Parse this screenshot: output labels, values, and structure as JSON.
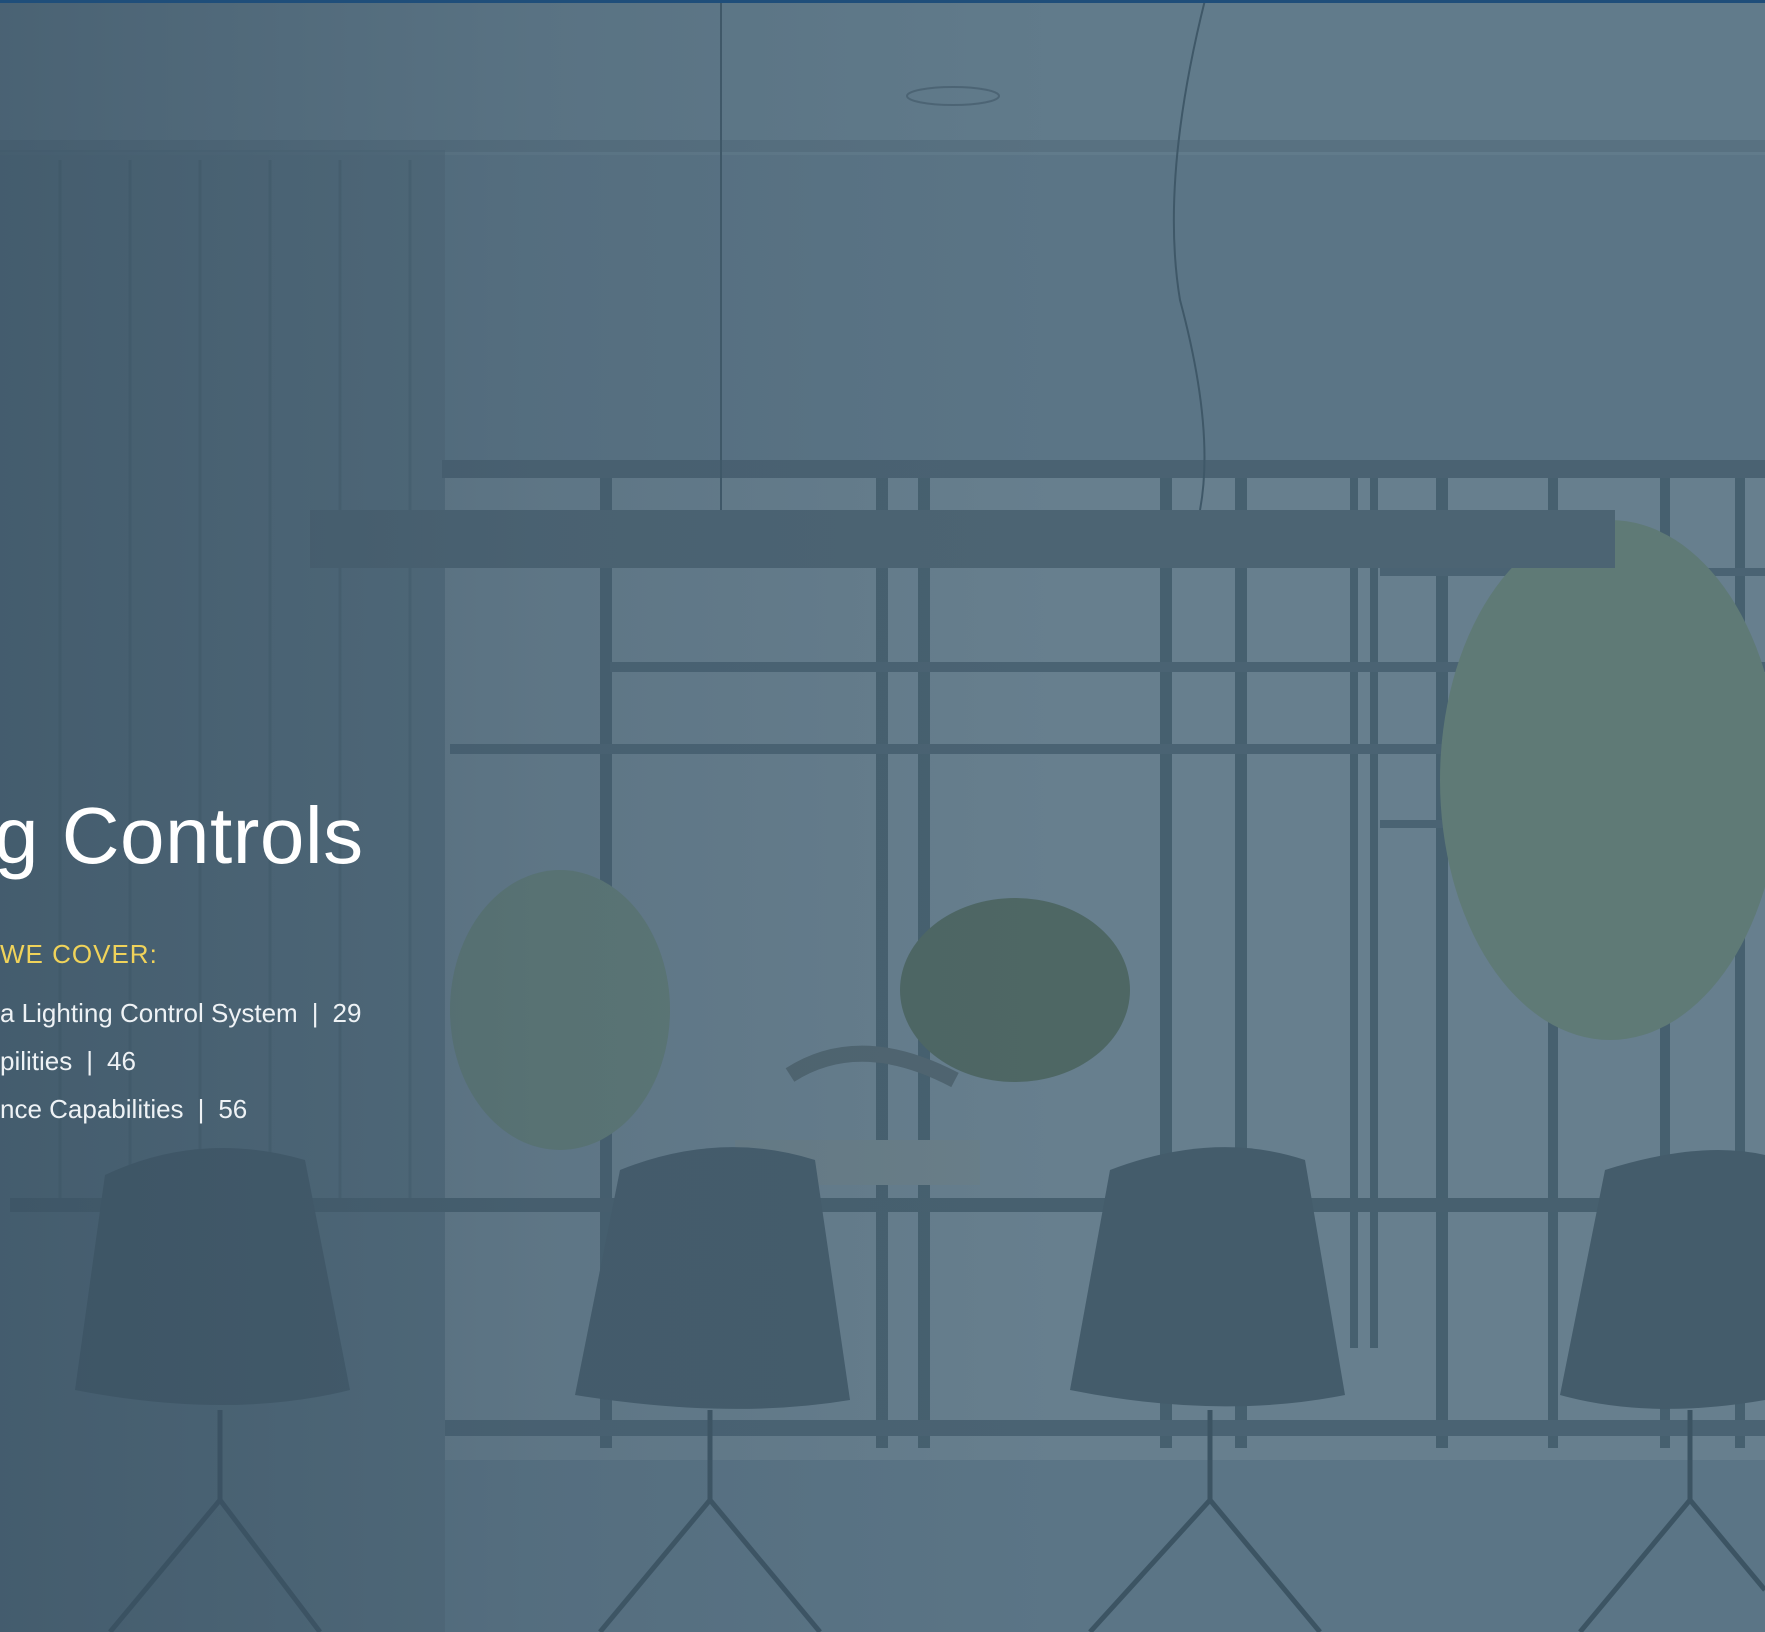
{
  "colors": {
    "title": "#ffffff",
    "heading_accent": "#f0d35a",
    "topic_text": "#eef2f5",
    "top_rule": "#1f4e7a",
    "background_tint": "#5a7384"
  },
  "title": "g Controls",
  "cover_heading": "WE COVER:",
  "topics": [
    {
      "text": "a Lighting Control System",
      "separator": "|",
      "page": "29"
    },
    {
      "text": "pilities",
      "separator": "|",
      "page": "46"
    },
    {
      "text": "nce Capabilities",
      "separator": "|",
      "page": "56"
    }
  ]
}
